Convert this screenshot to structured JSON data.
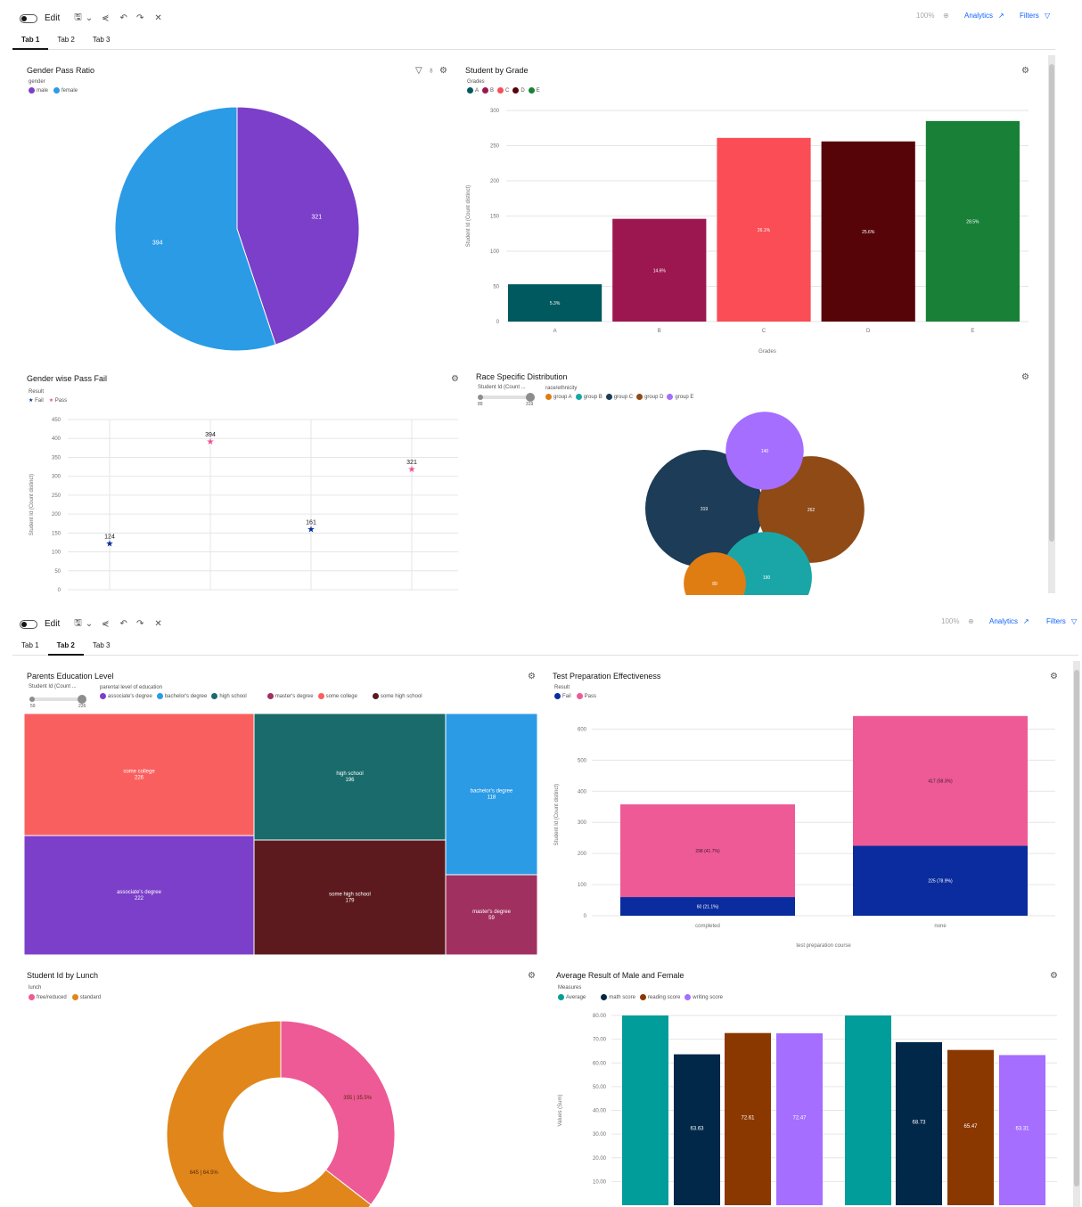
{
  "toolbar": {
    "edit_label": "Edit",
    "zoom": "100%",
    "analytics_label": "Analytics",
    "filters_label": "Filters"
  },
  "tabs": [
    "Tab 1",
    "Tab 2",
    "Tab 3"
  ],
  "screen1": {
    "active_tab": "Tab 1",
    "gender_pass_ratio": {
      "title": "Gender Pass Ratio",
      "legend_title": "gender",
      "legend": [
        {
          "label": "male",
          "color": "#7b3fc9"
        },
        {
          "label": "female",
          "color": "#2b9be6"
        }
      ]
    },
    "student_by_grade": {
      "title": "Student by Grade",
      "legend_title": "Grades",
      "legend": [
        {
          "label": "A",
          "color": "#00595e"
        },
        {
          "label": "B",
          "color": "#9c1750"
        },
        {
          "label": "C",
          "color": "#fa4d56"
        },
        {
          "label": "D",
          "color": "#570408"
        },
        {
          "label": "E",
          "color": "#198038"
        }
      ]
    },
    "gender_wise_pass_fail": {
      "title": "Gender wise Pass Fail",
      "legend_title": "Result",
      "legend": [
        {
          "label": "Fail",
          "color": "#002d9c"
        },
        {
          "label": "Pass",
          "color": "#ee5396"
        }
      ]
    },
    "race_specific_distribution": {
      "title": "Race Specific Distribution",
      "slider_label": "Student Id (Count ...",
      "slider_min": "89",
      "slider_max": "319",
      "legend_title": "race/ethnicity",
      "legend": [
        {
          "label": "group A",
          "color": "#e07d12"
        },
        {
          "label": "group B",
          "color": "#1aa6a6"
        },
        {
          "label": "group C",
          "color": "#1c3c57"
        },
        {
          "label": "group D",
          "color": "#8f4a16"
        },
        {
          "label": "group E",
          "color": "#a56eff"
        }
      ]
    }
  },
  "screen2": {
    "active_tab": "Tab 2",
    "parents_education": {
      "title": "Parents Education Level",
      "slider_label": "Student Id (Count ...",
      "slider_min": "59",
      "slider_max": "226",
      "legend_title": "parental level of education",
      "legend": [
        {
          "label": "associate's degree",
          "color": "#7b3fc9"
        },
        {
          "label": "bachelor's degree",
          "color": "#2b9be6"
        },
        {
          "label": "high school",
          "color": "#1a6b6b"
        },
        {
          "label": "master's degree",
          "color": "#a0305f"
        },
        {
          "label": "some college",
          "color": "#fa5f5f"
        },
        {
          "label": "some high school",
          "color": "#5c1a1e"
        }
      ]
    },
    "test_prep": {
      "title": "Test Preparation Effectiveness",
      "legend_title": "Result",
      "legend": [
        {
          "label": "Fail",
          "color": "#0a2c9e"
        },
        {
          "label": "Pass",
          "color": "#ee5a96"
        }
      ]
    },
    "lunch": {
      "title": "Student Id by Lunch",
      "legend_title": "lunch",
      "legend": [
        {
          "label": "free/reduced",
          "color": "#ee5a96"
        },
        {
          "label": "standard",
          "color": "#e0861a"
        }
      ]
    },
    "avg_result": {
      "title": "Average Result of Male and Female",
      "legend_title": "Measures",
      "legend": [
        {
          "label": "Average",
          "color": "#009d9a"
        },
        {
          "label": "math score",
          "color": "#012749"
        },
        {
          "label": "reading score",
          "color": "#8a3800"
        },
        {
          "label": "writing score",
          "color": "#a56eff"
        }
      ]
    }
  },
  "chart_data": [
    {
      "id": "gender_pass_ratio",
      "type": "pie",
      "title": "Gender Pass Ratio",
      "labels": [
        "male",
        "female"
      ],
      "values": [
        321,
        394
      ],
      "colors": [
        "#7b3fc9",
        "#2b9be6"
      ]
    },
    {
      "id": "student_by_grade",
      "type": "bar",
      "title": "Student by Grade",
      "categories": [
        "A",
        "B",
        "C",
        "D",
        "E"
      ],
      "values": [
        53,
        146,
        261,
        256,
        285
      ],
      "data_labels": [
        "5.3%",
        "14.6%",
        "26.1%",
        "25.6%",
        "28.5%"
      ],
      "colors": [
        "#00595e",
        "#9c1750",
        "#fa4d56",
        "#570408",
        "#198038"
      ],
      "xlabel": "Grades",
      "ylabel": "Student Id (Count distinct)",
      "ylim": [
        0,
        300
      ],
      "yticks": [
        0,
        50,
        100,
        150,
        200,
        250,
        300
      ]
    },
    {
      "id": "gender_wise_pass_fail",
      "type": "scatter",
      "title": "Gender wise Pass Fail",
      "ylabel": "Student Id (Count distinct)",
      "ylim": [
        0,
        450
      ],
      "yticks": [
        0,
        50,
        100,
        150,
        200,
        250,
        300,
        350,
        400,
        450
      ],
      "points": [
        {
          "slot": 0,
          "y": 124,
          "result": "Fail",
          "label": "124"
        },
        {
          "slot": 1,
          "y": 394,
          "result": "Pass",
          "label": "394"
        },
        {
          "slot": 2,
          "y": 161,
          "result": "Fail",
          "label": "161"
        },
        {
          "slot": 3,
          "y": 321,
          "result": "Pass",
          "label": "321"
        }
      ]
    },
    {
      "id": "race_specific_distribution",
      "type": "bubble",
      "title": "Race Specific Distribution",
      "bubbles": [
        {
          "group": "group C",
          "value": 319,
          "label": "319",
          "color": "#1c3c57"
        },
        {
          "group": "group D",
          "value": 262,
          "label": "262",
          "color": "#8f4a16"
        },
        {
          "group": "group B",
          "value": 190,
          "label": "190",
          "color": "#1aa6a6"
        },
        {
          "group": "group E",
          "value": 140,
          "label": "140",
          "color": "#a56eff"
        },
        {
          "group": "group A",
          "value": 89,
          "label": "89",
          "color": "#e07d12"
        }
      ]
    },
    {
      "id": "parents_education",
      "type": "treemap",
      "title": "Parents Education Level",
      "items": [
        {
          "label": "some college",
          "value": 226,
          "color": "#fa5f5f"
        },
        {
          "label": "associate's degree",
          "value": 222,
          "color": "#7b3fc9"
        },
        {
          "label": "high school",
          "value": 196,
          "color": "#1a6b6b"
        },
        {
          "label": "some high school",
          "value": 179,
          "color": "#5c1a1e"
        },
        {
          "label": "bachelor's degree",
          "value": 118,
          "color": "#2b9be6"
        },
        {
          "label": "master's degree",
          "value": 59,
          "color": "#a0305f"
        }
      ]
    },
    {
      "id": "test_prep",
      "type": "bar",
      "stacked": true,
      "title": "Test Preparation Effectiveness",
      "categories": [
        "completed",
        "none"
      ],
      "series": [
        {
          "name": "Fail",
          "values": [
            60,
            225
          ],
          "labels": [
            "60 (21.1%)",
            "225 (78.9%)"
          ],
          "color": "#0a2c9e"
        },
        {
          "name": "Pass",
          "values": [
            298,
            417
          ],
          "labels": [
            "298 (41.7%)",
            "417 (58.3%)"
          ],
          "color": "#ee5a96"
        }
      ],
      "xlabel": "test preparation course",
      "ylabel": "Student Id (Count distinct)",
      "ylim": [
        0,
        650
      ],
      "yticks": [
        0,
        100,
        200,
        300,
        400,
        500,
        600
      ]
    },
    {
      "id": "lunch",
      "type": "pie",
      "donut": true,
      "title": "Student Id by Lunch",
      "labels": [
        "free/reduced",
        "standard"
      ],
      "values": [
        355,
        645
      ],
      "data_labels": [
        "355 | 35.5%",
        "645 | 64.5%"
      ],
      "colors": [
        "#ee5a96",
        "#e0861a"
      ]
    },
    {
      "id": "avg_result",
      "type": "bar",
      "title": "Average Result of Male and Female",
      "ylabel": "Values (Sum)",
      "ylim": [
        0,
        80
      ],
      "yticks": [
        "10.00",
        "20.00",
        "30.00",
        "40.00",
        "50.00",
        "60.00",
        "70.00",
        "80.00"
      ],
      "bars": [
        {
          "measure": "Average",
          "value": 80,
          "label": "",
          "color": "#009d9a"
        },
        {
          "measure": "math score",
          "value": 63.63,
          "label": "63.63",
          "color": "#012749"
        },
        {
          "measure": "reading score",
          "value": 72.61,
          "label": "72.61",
          "color": "#8a3800"
        },
        {
          "measure": "writing score",
          "value": 72.47,
          "label": "72.47",
          "color": "#a56eff"
        },
        {
          "measure": "Average",
          "value": 80,
          "label": "",
          "color": "#009d9a"
        },
        {
          "measure": "math score",
          "value": 68.73,
          "label": "68.73",
          "color": "#012749"
        },
        {
          "measure": "reading score",
          "value": 65.47,
          "label": "65.47",
          "color": "#8a3800"
        },
        {
          "measure": "writing score",
          "value": 63.31,
          "label": "63.31",
          "color": "#a56eff"
        }
      ]
    }
  ]
}
